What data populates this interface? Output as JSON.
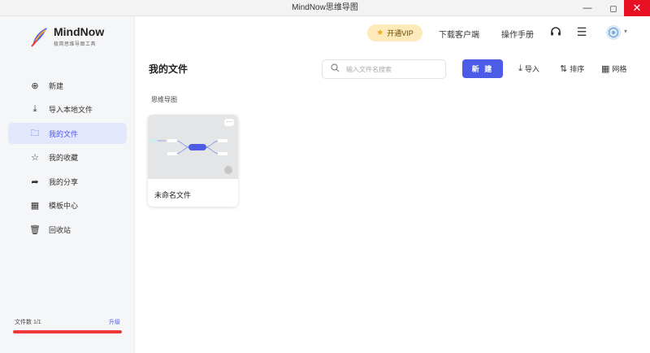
{
  "window": {
    "title": "MindNow思维导图",
    "minimize_icon": "minimize-icon",
    "maximize_icon": "maximize-icon",
    "close_icon": "close-icon"
  },
  "sidebar": {
    "logo": {
      "name": "MindNow",
      "subtitle": "极简思维导图工具",
      "icon": "feather-logo-icon"
    },
    "items": [
      {
        "label": "新建",
        "icon": "plus-circle-icon",
        "active": false
      },
      {
        "label": "导入本地文件",
        "icon": "import-icon",
        "active": false
      },
      {
        "label": "我的文件",
        "icon": "folder-icon",
        "active": true
      },
      {
        "label": "我的收藏",
        "icon": "star-icon",
        "active": false
      },
      {
        "label": "我的分享",
        "icon": "share-icon",
        "active": false
      },
      {
        "label": "模板中心",
        "icon": "template-grid-icon",
        "active": false
      },
      {
        "label": "回收站",
        "icon": "trash-icon",
        "active": false
      }
    ],
    "footer": {
      "count_label": "文件数 1/1",
      "upgrade_label": "升级",
      "usage_fraction": 1.0
    }
  },
  "header": {
    "vip_label": "开通VIP",
    "download_label": "下载客户端",
    "manual_label": "操作手册",
    "headset_icon": "headset-icon",
    "menu_icon": "menu-icon",
    "avatar_icon": "avatar-icon"
  },
  "main": {
    "title": "我的文件",
    "search_placeholder": "输入文件名搜索",
    "new_button": "新 建",
    "import_label": "导入",
    "sort_label": "排序",
    "grid_label": "网格",
    "section_label": "思维导图",
    "files": [
      {
        "name": "未命名文件"
      }
    ]
  },
  "colors": {
    "accent": "#4d5ce6",
    "active_bg": "#e3e7fb",
    "vip_bg": "#fde9b9",
    "close_red": "#e81123",
    "quota_bar": "#ee3a3a"
  }
}
